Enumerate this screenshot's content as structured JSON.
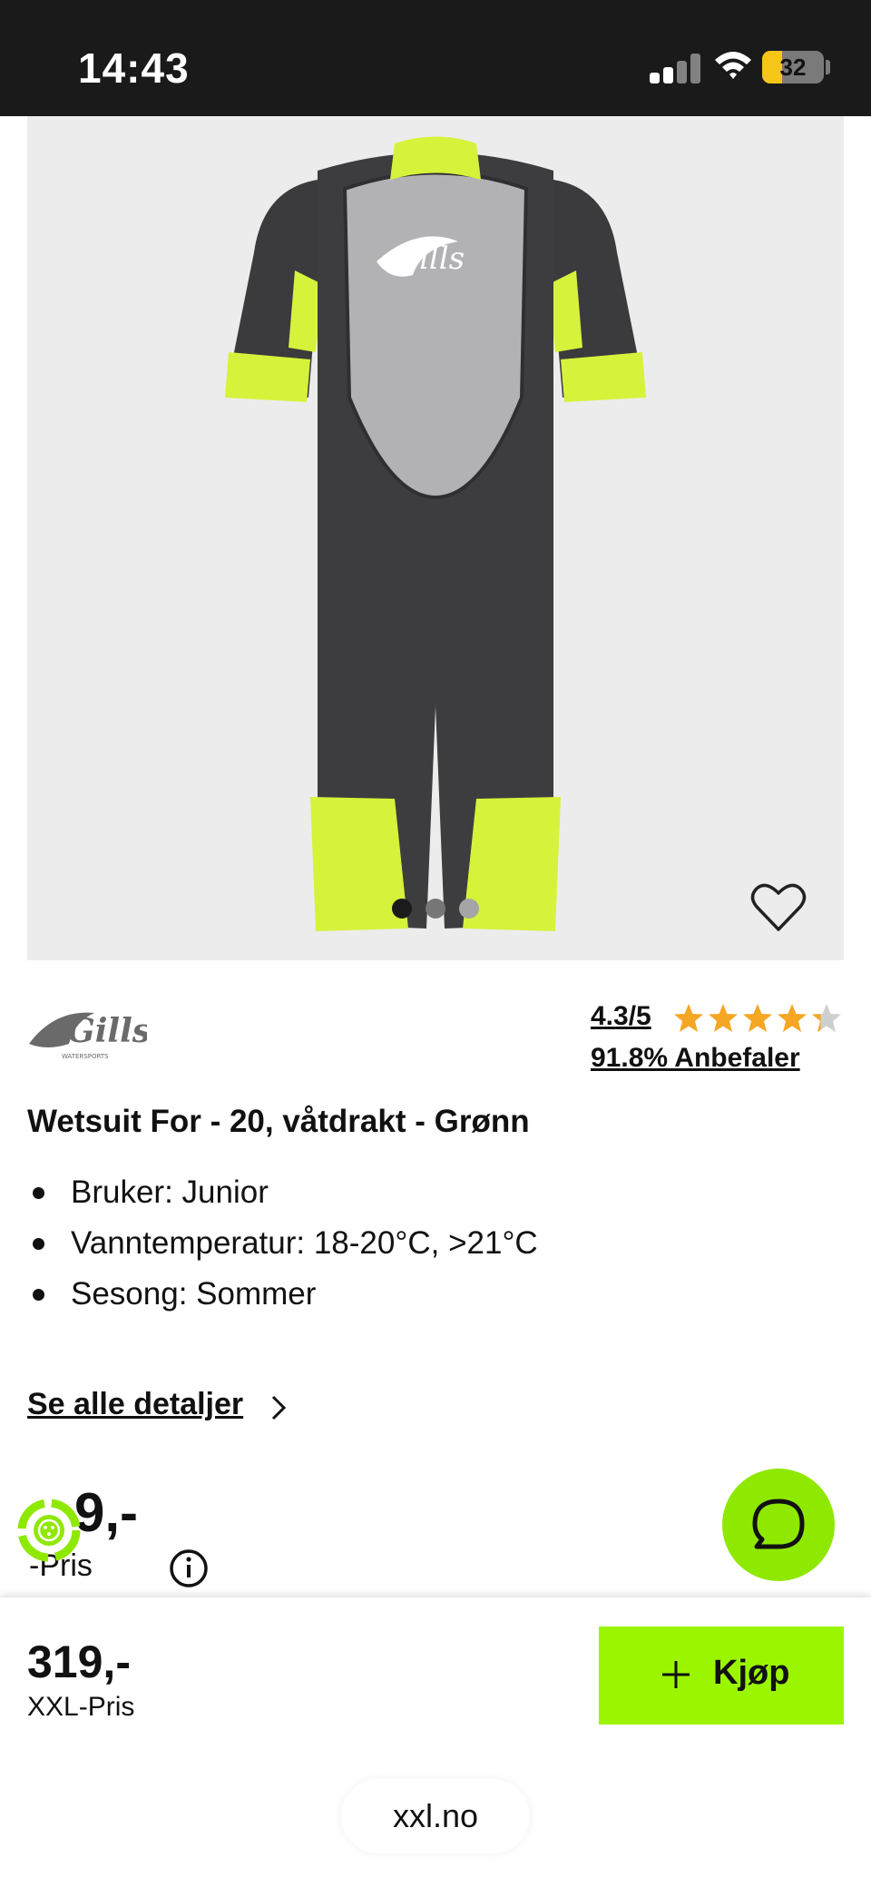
{
  "status_bar": {
    "time": "14:43",
    "battery": "32",
    "battery_level": 0.32,
    "signal_icon": "cellular-signal-icon",
    "wifi_icon": "wifi-icon"
  },
  "gallery": {
    "image": "wetsuit-product-image",
    "image_count": 3,
    "active_index": 0,
    "favorite_icon": "heart-icon"
  },
  "brand": {
    "logo_text": "Gills",
    "logo_subtext": "WATERSPORTS"
  },
  "rating": {
    "score": "4.3/5",
    "stars_value": 4.3,
    "stars_max": 5,
    "recommend": "91.8% Anbefaler"
  },
  "product": {
    "title": "Wetsuit For - 20, våtdrakt - Grønn",
    "bullets": [
      "Bruker: Junior",
      "Vanntemperatur: 18-20°C, >21°C",
      "Sesong: Sommer"
    ],
    "details_link": "Se alle detaljer"
  },
  "price": {
    "visible_price": "9,-",
    "label": "-Pris",
    "info_icon": "info-icon",
    "loyalty_icon": "loyalty-badge-icon"
  },
  "chat": {
    "icon": "chat-bubble-icon"
  },
  "bottom_bar": {
    "price": "319,-",
    "label": "XXL-Pris",
    "buy_label": "Kjøp",
    "buy_icon": "plus-icon"
  },
  "browser": {
    "url": "xxl.no"
  },
  "colors": {
    "accent_green": "#9cf500",
    "chat_green": "#8fe800",
    "star_orange": "#f5a623",
    "status_bar_bg": "#1a1a1a",
    "hero_bg": "#ececec"
  }
}
